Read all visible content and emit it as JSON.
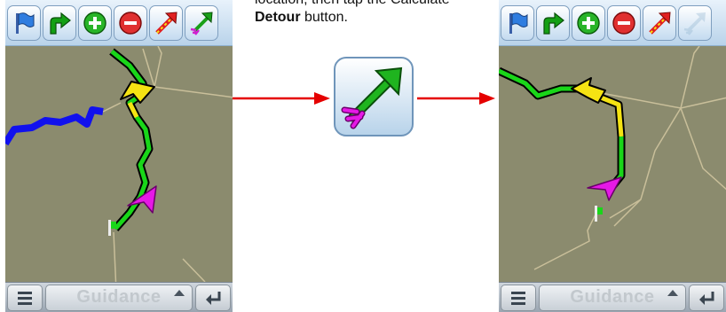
{
  "caption": {
    "line1_text": "location, then tap the Calculate",
    "line2_bold": "Detour",
    "line2_rest": " button."
  },
  "toolbar": {
    "buttons": [
      {
        "icon": "flag-icon"
      },
      {
        "icon": "turn-arrow-icon"
      },
      {
        "icon": "zoom-in-icon"
      },
      {
        "icon": "zoom-out-icon"
      },
      {
        "icon": "route-arrow-icon"
      },
      {
        "icon": "detour-arrow-icon"
      }
    ]
  },
  "bottombar": {
    "guidance_label": "Guidance"
  },
  "colors": {
    "map_background": "#8b8b6e",
    "route_green": "#19d619",
    "route_yellow": "#f5e313",
    "alternate_route_blue": "#1111ee",
    "position_marker": "#e619e6",
    "road": "#c9bf9a",
    "connector_arrow": "#e50000"
  }
}
